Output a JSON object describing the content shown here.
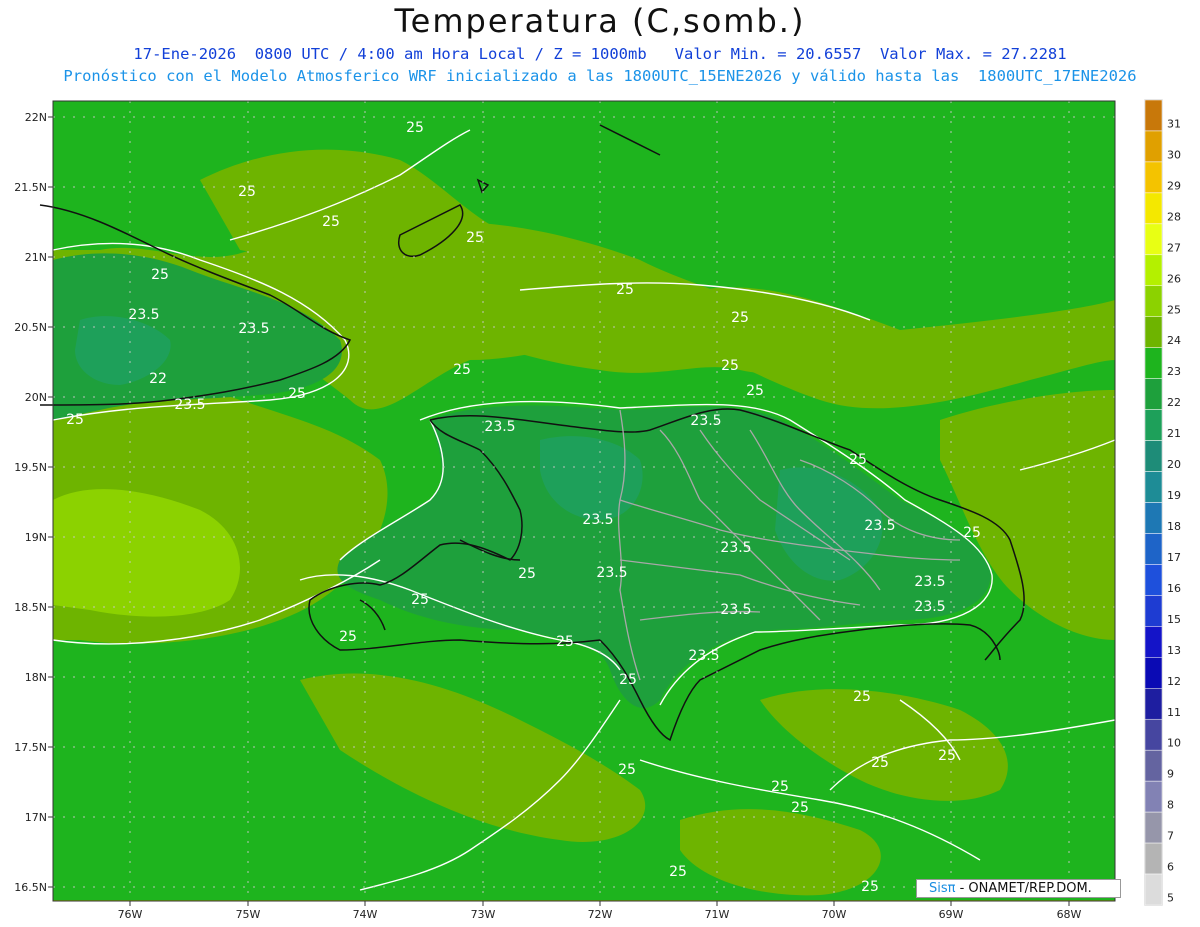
{
  "title": "Temperatura (C,somb.)",
  "subtitle_line1": "17-Ene-2026  0800 UTC / 4:00 am Hora Local / Z = 1000mb   Valor Min. = 20.6557  Valor Max. = 27.2281",
  "subtitle_line2": "Pronóstico con el Modelo Atmosferico WRF inicializado a las 1800UTC_15ENE2026 y válido hasta las  1800UTC_17ENE2026",
  "credit": {
    "brand": "Sisπ",
    "rest": " - ONAMET/REP.DOM."
  },
  "lat_labels": [
    "22N",
    "21.5N",
    "21N",
    "20.5N",
    "20N",
    "19.5N",
    "19N",
    "18.5N",
    "18N",
    "17.5N",
    "17N",
    "16.5N"
  ],
  "lon_labels": [
    "76W",
    "75W",
    "74W",
    "73W",
    "72W",
    "71W",
    "70W",
    "69W",
    "68W"
  ],
  "colorbar": {
    "levels": [
      "31",
      "30",
      "29",
      "28",
      "27",
      "26",
      "25",
      "24",
      "23",
      "22",
      "21",
      "20",
      "19",
      "18",
      "17",
      "16",
      "15",
      "13",
      "12",
      "11",
      "10",
      "9",
      "8",
      "7",
      "6",
      "5"
    ],
    "colors": [
      "#c8780a",
      "#e0a000",
      "#f4c300",
      "#f4e800",
      "#e8ff14",
      "#b4f000",
      "#8cd200",
      "#6eb400",
      "#1eb41e",
      "#1ea03c",
      "#1ea05a",
      "#1e8c78",
      "#1e8c96",
      "#1e78b4",
      "#1e64c8",
      "#1e50dc",
      "#1e3cd2",
      "#1414c8",
      "#0a0ab4",
      "#1e1ea0",
      "#4646a0",
      "#6464a0",
      "#8282b4",
      "#9696aa",
      "#b4b4b4",
      "#dcdcdc"
    ]
  },
  "contour_labels": [
    {
      "text": "25"
    },
    {
      "text": "25"
    },
    {
      "text": "25"
    },
    {
      "text": "25"
    },
    {
      "text": "25"
    },
    {
      "text": "25"
    },
    {
      "text": "25"
    },
    {
      "text": "25"
    },
    {
      "text": "25"
    },
    {
      "text": "25"
    },
    {
      "text": "25"
    },
    {
      "text": "25"
    },
    {
      "text": "25"
    },
    {
      "text": "25"
    },
    {
      "text": "25"
    },
    {
      "text": "25"
    },
    {
      "text": "25"
    },
    {
      "text": "25"
    },
    {
      "text": "25"
    },
    {
      "text": "25"
    },
    {
      "text": "25"
    },
    {
      "text": "25"
    },
    {
      "text": "25"
    },
    {
      "text": "25"
    },
    {
      "text": "25"
    },
    {
      "text": "23.5"
    },
    {
      "text": "23.5"
    },
    {
      "text": "23.5"
    },
    {
      "text": "23.5"
    },
    {
      "text": "23.5"
    },
    {
      "text": "23.5"
    },
    {
      "text": "23.5"
    },
    {
      "text": "23.5"
    },
    {
      "text": "23.5"
    },
    {
      "text": "23.5"
    },
    {
      "text": "23.5"
    },
    {
      "text": "23.5"
    },
    {
      "text": "23.5"
    },
    {
      "text": "22"
    }
  ]
}
